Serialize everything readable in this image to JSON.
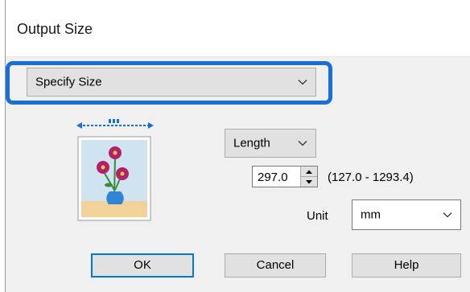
{
  "dialog": {
    "title": "Output Size"
  },
  "size_select": {
    "value": "Specify Size"
  },
  "dimension_select": {
    "value": "Length"
  },
  "size_input": {
    "value": "297.0"
  },
  "range_text": "(127.0 - 1293.4)",
  "unit": {
    "label": "Unit",
    "value": "mm"
  },
  "buttons": {
    "ok": "OK",
    "cancel": "Cancel",
    "help": "Help"
  },
  "colors": {
    "highlight": "#1a6fd6",
    "focus": "#0078d7"
  }
}
